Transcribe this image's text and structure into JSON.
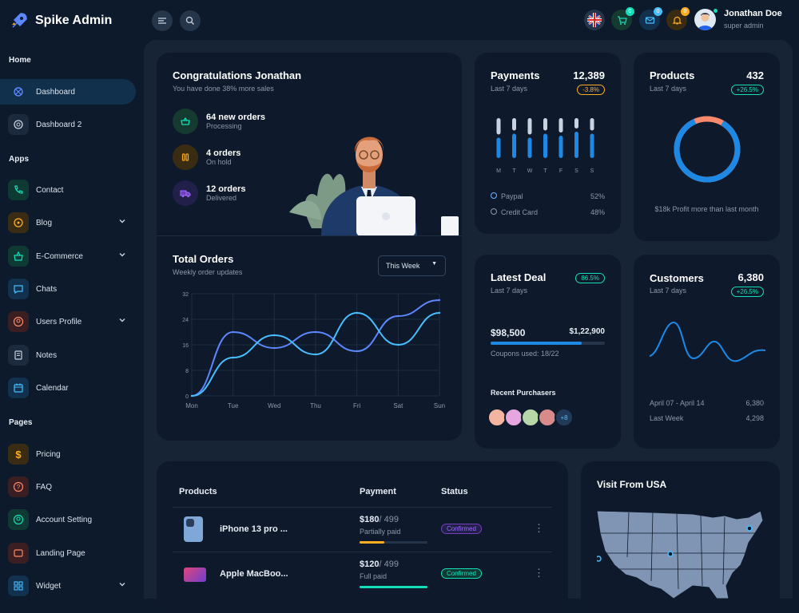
{
  "app": {
    "name": "Spike Admin"
  },
  "sidebar": {
    "sections": [
      "Home",
      "Apps",
      "Pages"
    ],
    "items": [
      {
        "label": "Dashboard",
        "icon": "dashboard-icon"
      },
      {
        "label": "Dashboard 2",
        "icon": "aperture-icon"
      },
      {
        "label": "Contact",
        "icon": "phone-icon"
      },
      {
        "label": "Blog",
        "icon": "chat-bubble-icon"
      },
      {
        "label": "E-Commerce",
        "icon": "basket-icon"
      },
      {
        "label": "Chats",
        "icon": "message-icon"
      },
      {
        "label": "Users Profile",
        "icon": "user-circle-icon"
      },
      {
        "label": "Notes",
        "icon": "notes-icon"
      },
      {
        "label": "Calendar",
        "icon": "calendar-icon"
      },
      {
        "label": "Pricing",
        "icon": "dollar-icon"
      },
      {
        "label": "FAQ",
        "icon": "question-icon"
      },
      {
        "label": "Account Setting",
        "icon": "user-settings-icon"
      },
      {
        "label": "Landing Page",
        "icon": "app-window-icon"
      },
      {
        "label": "Widget",
        "icon": "layout-grid-icon"
      }
    ]
  },
  "header": {
    "cart_count": "0",
    "mail_count": "0",
    "bell_count": "0",
    "user_name": "Jonathan Doe",
    "user_role": "super admin"
  },
  "welcome": {
    "title": "Congratulations Jonathan",
    "subtitle": "You have done 38% more sales",
    "stats": [
      {
        "title": "64 new orders",
        "sub": "Processing"
      },
      {
        "title": "4 orders",
        "sub": "On hold"
      },
      {
        "title": "12 orders",
        "sub": "Delivered"
      }
    ]
  },
  "orders": {
    "title": "Total Orders",
    "subtitle": "Weekly order updates",
    "period": "This Week",
    "chart_data": {
      "type": "line",
      "categories": [
        "Mon",
        "Tue",
        "Wed",
        "Thu",
        "Fri",
        "Sat",
        "Sun"
      ],
      "series": [
        {
          "name": "",
          "values": [
            0,
            20,
            15,
            20,
            14,
            25,
            30
          ]
        },
        {
          "name": "",
          "values": [
            0,
            12,
            19,
            13,
            26,
            16,
            26
          ]
        }
      ],
      "yticks": [
        "32",
        "24",
        "16",
        "8",
        "0"
      ],
      "ylim": [
        0,
        32
      ],
      "colors": [
        "#5d87ff",
        "#49beff"
      ]
    }
  },
  "payments": {
    "title": "Payments",
    "value": "12,389",
    "subtitle": "Last 7 days",
    "change": "-3.8%",
    "days": [
      "M",
      "T",
      "W",
      "T",
      "F",
      "S",
      "S"
    ],
    "bar_levels": [
      0.45,
      0.35,
      0.45,
      0.35,
      0.4,
      0.3,
      0.35
    ],
    "legend": [
      {
        "label": "Paypal",
        "value": "52%"
      },
      {
        "label": "Credit Card",
        "value": "48%"
      }
    ]
  },
  "products_card": {
    "title": "Products",
    "value": "432",
    "subtitle": "Last 7 days",
    "change": "+26.5%",
    "note": "$18k Profit more than last month",
    "donut_share": 0.85
  },
  "deal": {
    "title": "Latest Deal",
    "subtitle": "Last 7 days",
    "change": "86.5%",
    "amount": "$98,500",
    "target": "$1,22,900",
    "coupons": "Coupons used: 18/22",
    "progress": 0.8,
    "purchasers_title": "Recent Purchasers",
    "more": "+8"
  },
  "customers": {
    "title": "Customers",
    "value": "6,380",
    "subtitle": "Last 7 days",
    "change": "+26.5%",
    "rows": [
      {
        "label": "April 07 - April 14",
        "value": "6,380"
      },
      {
        "label": "Last Week",
        "value": "4,298"
      }
    ]
  },
  "table": {
    "headers": [
      "Products",
      "Payment",
      "Status"
    ],
    "rows": [
      {
        "name": "iPhone 13 pro ...",
        "paid": "$180",
        "total": "/ 499",
        "state": "Partially paid",
        "status": "Confirmed",
        "progress": 0.36,
        "bar_color": "#ffae1f"
      },
      {
        "name": "Apple MacBoo...",
        "paid": "$120",
        "total": "/ 499",
        "state": "Full paid",
        "status": "Confirmed",
        "progress": 1,
        "bar_color": "#13deb9"
      }
    ]
  },
  "map": {
    "title": "Visit From USA"
  }
}
